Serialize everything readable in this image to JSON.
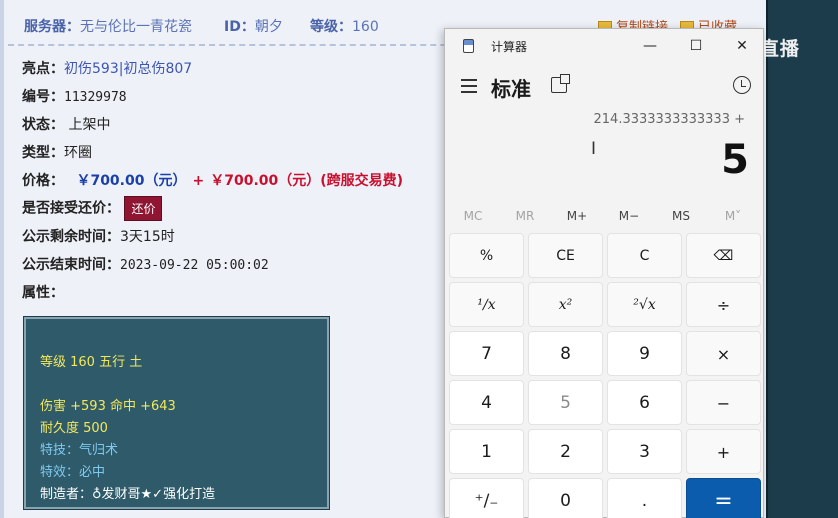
{
  "header": {
    "server_label": "服务器：",
    "server_value": "无与伦比一青花瓷",
    "id_label": "ID：",
    "id_value": "朝夕",
    "level_label": "等级：",
    "level_value": "160",
    "copy_link": "复制链接",
    "favorited": "已收藏"
  },
  "item": {
    "highlight_label": "亮点：",
    "highlight_value": "初伤593|初总伤807",
    "number_label": "编号：",
    "number_value": "11329978",
    "status_label": "状态：",
    "status_value": "上架中",
    "type_label": "类型：",
    "type_value": "环圈",
    "price_label": "价格：",
    "price_value": "￥700.00（元）",
    "price_plus": "+",
    "fee_value": "￥700.00（元）(跨服交易费)",
    "haggle_label": "是否接受还价：",
    "haggle_button": "还价",
    "remaining_label": "公示剩余时间：",
    "remaining_value": "3天15时",
    "end_label": "公示结束时间：",
    "end_value": "2023-09-22 05:00:02",
    "attr_label": "属性："
  },
  "attributes": {
    "level_line": "等级 160 五行 土",
    "damage_line": "伤害 +593 命中 +643",
    "durability_line": "耐久度 500",
    "skill_line": "特技：气归术",
    "effect_line": "特效：必中",
    "maker_line": "制造者：♁发财哥★✓强化打造"
  },
  "watermark": "CC直播",
  "calculator": {
    "window_title": "计算器",
    "mode_title": "标准",
    "expression": "214.3333333333333 +",
    "display": "5",
    "memory": [
      "MC",
      "MR",
      "M+",
      "M−",
      "MS",
      "M˅"
    ],
    "keys": [
      [
        "%",
        "CE",
        "C",
        "⌫"
      ],
      [
        "¹∕x",
        "x²",
        "²√x",
        "÷"
      ],
      [
        "7",
        "8",
        "9",
        "×"
      ],
      [
        "4",
        "5",
        "6",
        "−"
      ],
      [
        "1",
        "2",
        "3",
        "+"
      ],
      [
        "⁺∕₋",
        "0",
        ".",
        "="
      ]
    ],
    "minimize": "—",
    "maximize": "☐",
    "close": "✕"
  },
  "colors": {
    "page_bg": "#eef1f8",
    "attr_box_bg": "#2f5a6a",
    "equals_key": "#0b5cad",
    "price_blue": "#1b3fa8",
    "price_red": "#c8102e",
    "haggle_button": "#8f1533"
  }
}
